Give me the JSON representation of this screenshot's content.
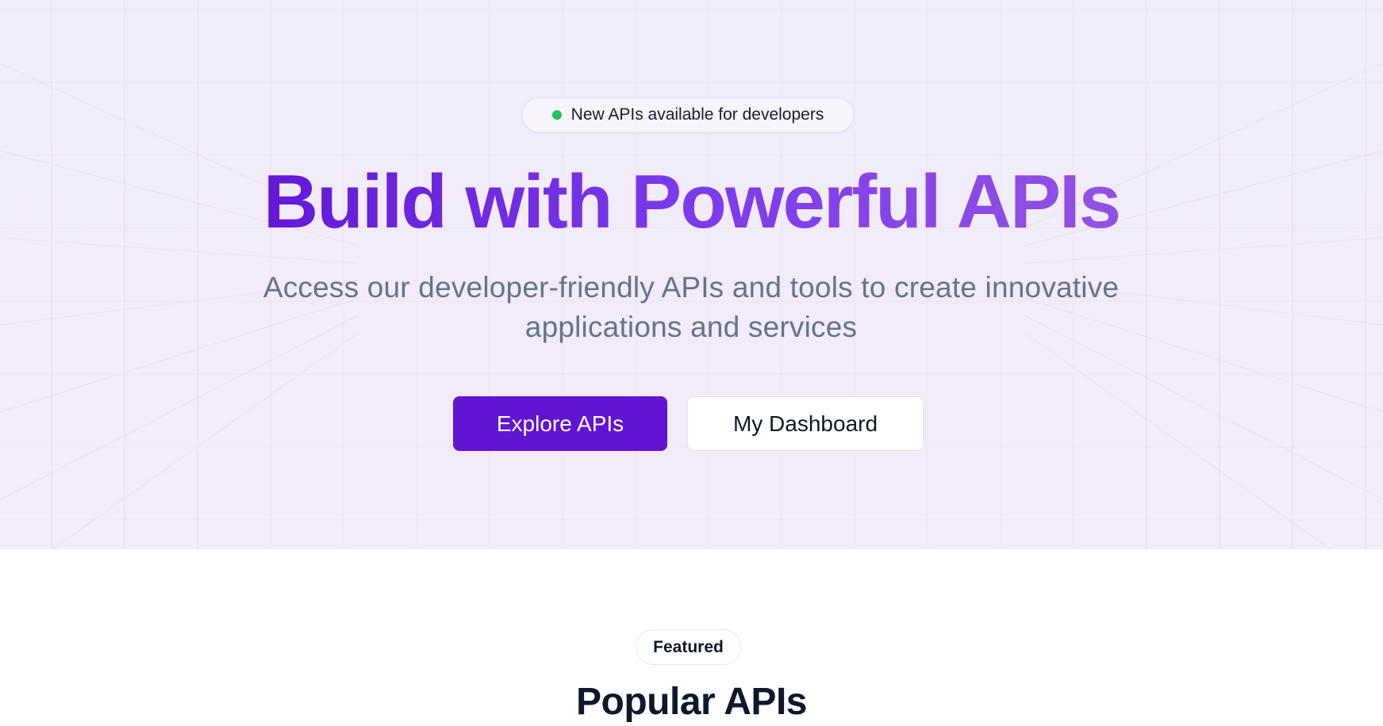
{
  "hero": {
    "announcement": {
      "text": "New APIs available for developers",
      "dot_color": "#22c55e"
    },
    "headline": "Build with Powerful APIs",
    "headline_gradient": [
      "#6419d6",
      "#7c3aed",
      "#9351e3"
    ],
    "subtitle": "Access our developer-friendly APIs and tools to create innovative applications and services",
    "buttons": {
      "primary_label": "Explore APIs",
      "secondary_label": "My Dashboard"
    }
  },
  "featured_section": {
    "badge": "Featured",
    "title": "Popular APIs"
  },
  "colors": {
    "accent": "#6214d3",
    "hero_background": "#f1ecfa",
    "text_muted": "#64748b",
    "text_dark": "#0f172a"
  }
}
